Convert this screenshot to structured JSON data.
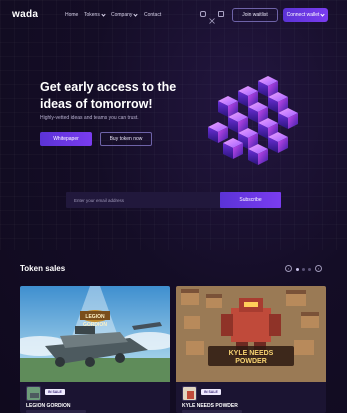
{
  "nav": {
    "logo": "wada",
    "links": [
      {
        "label": "Home",
        "dropdown": false
      },
      {
        "label": "Tokens",
        "dropdown": true
      },
      {
        "label": "Company",
        "dropdown": true
      },
      {
        "label": "Contact",
        "dropdown": false
      }
    ],
    "social_icons": [
      "instagram-icon",
      "x-twitter-icon",
      "linkedin-icon"
    ],
    "join_label": "Join waitlist",
    "connect_label": "Connect wallet"
  },
  "hero": {
    "title": "Get early access to the ideas of tomorrow!",
    "subtitle": "Highly-vetted ideas and teams you can trust.",
    "whitepaper_label": "Whitepaper",
    "buy_label": "Buy token now",
    "art_icon": "crystal-cubes-illustration"
  },
  "email": {
    "placeholder": "Enter your email address",
    "value": "",
    "subscribe_label": "Subscribe"
  },
  "token_sales": {
    "title": "Token sales",
    "carousel": {
      "pages": 3,
      "active": 0
    },
    "cards": [
      {
        "title": "LEGION GORDION",
        "badge": "IN SALE",
        "image_icon": "legion-gordion-game-art"
      },
      {
        "title": "KYLE NEEDS POWDER",
        "badge": "IN SALE",
        "image_icon": "kyle-needs-powder-game-art"
      }
    ]
  },
  "colors": {
    "background": "#120c22",
    "accent": "#6a38e6",
    "outline": "#6e63a8"
  }
}
